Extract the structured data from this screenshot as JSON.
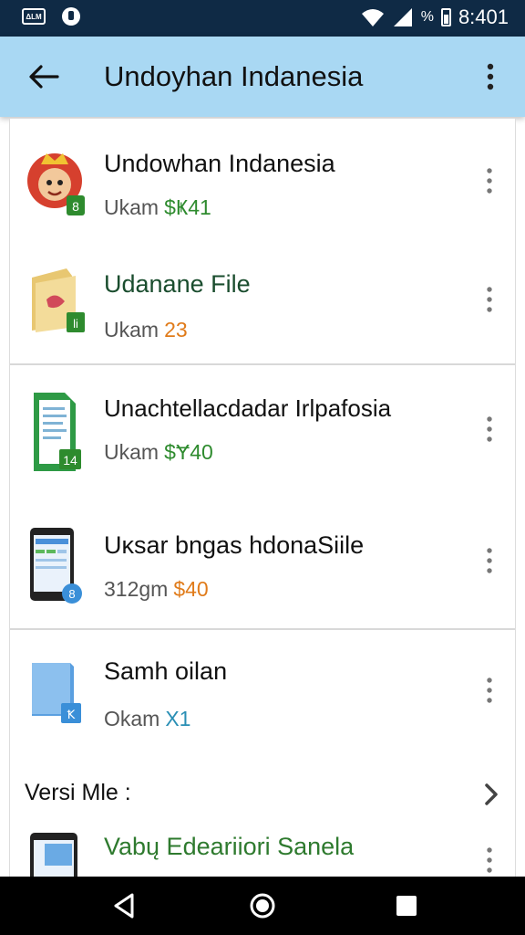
{
  "status_bar": {
    "carrier_icon_label": "ΔLM",
    "time": "8:401",
    "battery_text": "%",
    "icons": [
      "carrier-icon",
      "key-icon",
      "wifi-icon",
      "signal-icon",
      "battery-icon"
    ]
  },
  "app_bar": {
    "title": "Undoyhan Indanesia",
    "back_icon": "arrow-left-icon",
    "menu_icon": "more-vert-icon"
  },
  "items": [
    {
      "title": "Undowhan Indanesia",
      "sub_label": "Ukam",
      "price": "$Ҝ41",
      "price_color": "#2e8b2e",
      "badge": "8",
      "badge_color": "#2e8b2e",
      "icon": "mascot-app-icon"
    },
    {
      "title": "Udanane File",
      "sub_label": "Ukam",
      "price": "23",
      "price_color": "#e07b1a",
      "badge": "li",
      "badge_color": "#2e8b2e",
      "icon": "folder-app-icon"
    },
    {
      "title": "Unachtellacdadar Irlpafosia",
      "sub_label": "Ukam",
      "price": "$Ɏ40",
      "price_color": "#2e8b2e",
      "badge": "14",
      "badge_color": "#2e8b2e",
      "icon": "sheet-app-icon"
    },
    {
      "title": "Uĸsar bngas hdonaSiile",
      "sub_label": "312gm",
      "price": "$40",
      "price_color": "#e07b1a",
      "badge": "8",
      "badge_color": "#3a8fd8",
      "icon": "tablet-app-icon"
    },
    {
      "title": "Samh oilan",
      "sub_label": "Okam",
      "price": "X1",
      "price_color": "#2a8fb5",
      "badge": "Ꝁ",
      "badge_color": "#3a8fd8",
      "icon": "box-app-icon"
    }
  ],
  "section": {
    "label": "Versi Mle :",
    "chevron_icon": "chevron-right-icon"
  },
  "partial_item": {
    "title": "Vabų Edeariiori Sanela",
    "title_color": "#2e7a2e",
    "icon": "tablet-app-icon"
  },
  "nav_bar": {
    "icons": [
      "back-triangle-icon",
      "home-circle-icon",
      "recents-square-icon"
    ]
  }
}
